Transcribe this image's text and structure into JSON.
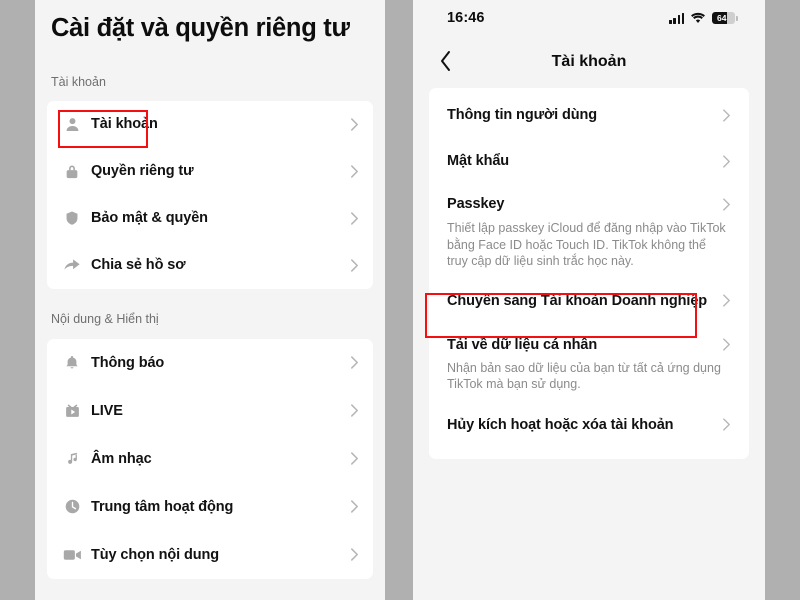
{
  "left_panel": {
    "page_title": "Cài đặt và quyền riêng tư",
    "sections": [
      {
        "header": "Tài khoản",
        "items": [
          {
            "label": "Tài khoản",
            "icon": "person-icon",
            "highlighted": true
          },
          {
            "label": "Quyền riêng tư",
            "icon": "lock-icon",
            "highlighted": false
          },
          {
            "label": "Bảo mật & quyền",
            "icon": "shield-icon",
            "highlighted": false
          },
          {
            "label": "Chia sẻ hồ sơ",
            "icon": "share-arrow-icon",
            "highlighted": false
          }
        ]
      },
      {
        "header": "Nội dung & Hiển thị",
        "items": [
          {
            "label": "Thông báo",
            "icon": "bell-icon",
            "highlighted": false
          },
          {
            "label": "LIVE",
            "icon": "tv-icon",
            "highlighted": false
          },
          {
            "label": "Âm nhạc",
            "icon": "music-note-icon",
            "highlighted": false
          },
          {
            "label": "Trung tâm hoạt động",
            "icon": "clock-icon",
            "highlighted": false
          },
          {
            "label": "Tùy chọn nội dung",
            "icon": "video-camera-icon",
            "highlighted": false
          }
        ]
      }
    ]
  },
  "right_panel": {
    "status_bar": {
      "time": "16:46",
      "battery_percent": "64",
      "signal_icon": "cellular-bars-icon",
      "wifi_icon": "wifi-icon",
      "battery_icon": "battery-icon"
    },
    "nav": {
      "back_icon": "chevron-left-icon",
      "title": "Tài khoản"
    },
    "items": [
      {
        "label": "Thông tin người dùng",
        "desc": "",
        "highlighted": false
      },
      {
        "label": "Mật khẩu",
        "desc": "",
        "highlighted": false
      },
      {
        "label": "Passkey",
        "desc": "Thiết lập passkey iCloud để đăng nhập vào TikTok bằng Face ID hoặc Touch ID. TikTok không thể truy cập dữ liệu sinh trắc học này.",
        "highlighted": false
      },
      {
        "label": "Chuyển sang Tài khoản Doanh nghiệp",
        "desc": "",
        "highlighted": true
      },
      {
        "label": "Tải về dữ liệu cá nhân",
        "desc": "Nhận bản sao dữ liệu của bạn từ tất cả ứng dụng TikTok mà bạn sử dụng.",
        "highlighted": false
      },
      {
        "label": "Hủy kích hoạt hoặc xóa tài khoản",
        "desc": "",
        "highlighted": false
      }
    ]
  },
  "annotation": {
    "highlight_color": "#f60f11",
    "boxes": [
      {
        "name": "account-row-highlight"
      },
      {
        "name": "switch-business-account-highlight"
      }
    ]
  }
}
